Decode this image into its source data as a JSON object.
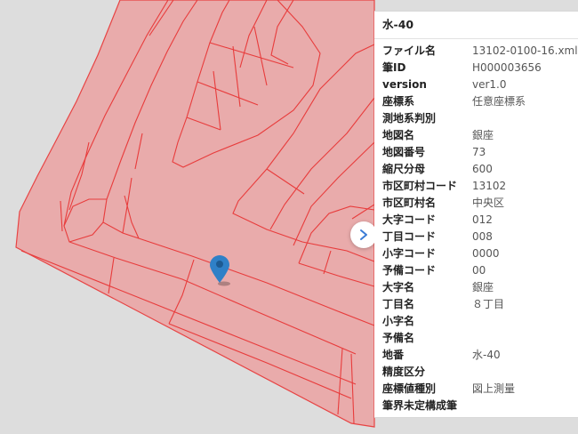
{
  "panel": {
    "title": "水-40",
    "attributes": [
      {
        "key": "ファイル名",
        "value": "13102-0100-16.xml"
      },
      {
        "key": "筆ID",
        "value": "H000003656"
      },
      {
        "key": "version",
        "value": "ver1.0"
      },
      {
        "key": "座標系",
        "value": "任意座標系"
      },
      {
        "key": "測地系判別",
        "value": ""
      },
      {
        "key": "地図名",
        "value": "銀座"
      },
      {
        "key": "地図番号",
        "value": "73"
      },
      {
        "key": "縮尺分母",
        "value": "600"
      },
      {
        "key": "市区町村コード",
        "value": "13102"
      },
      {
        "key": "市区町村名",
        "value": "中央区"
      },
      {
        "key": "大字コード",
        "value": "012"
      },
      {
        "key": "丁目コード",
        "value": "008"
      },
      {
        "key": "小字コード",
        "value": "0000"
      },
      {
        "key": "予備コード",
        "value": "00"
      },
      {
        "key": "大字名",
        "value": "銀座"
      },
      {
        "key": "丁目名",
        "value": "８丁目"
      },
      {
        "key": "小字名",
        "value": ""
      },
      {
        "key": "予備名",
        "value": ""
      },
      {
        "key": "地番",
        "value": "水-40"
      },
      {
        "key": "精度区分",
        "value": ""
      },
      {
        "key": "座標値種別",
        "value": "図上測量"
      },
      {
        "key": "筆界未定構成筆",
        "value": ""
      }
    ]
  },
  "icons": {
    "marker": "map-marker-icon",
    "toggle": "chevron-right-icon"
  },
  "colors": {
    "parcel_fill": "#eaa9a9",
    "parcel_line": "#e83c3c",
    "marker": "#2f80c7",
    "map_background": "#dddddd"
  }
}
